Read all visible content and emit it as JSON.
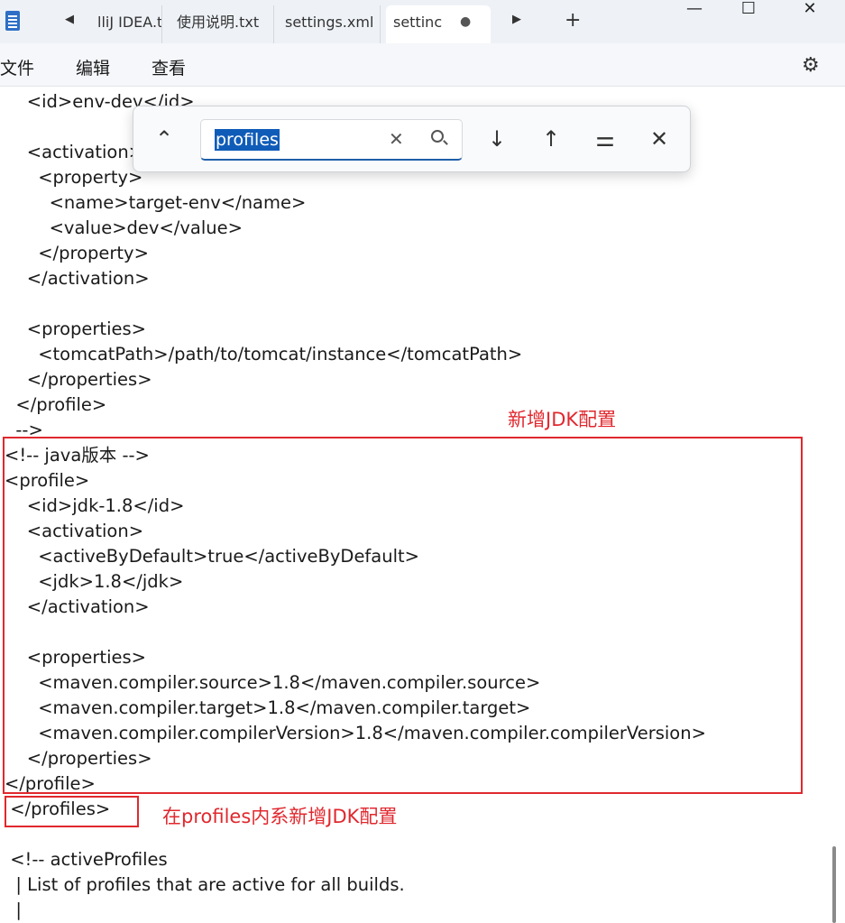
{
  "tabs": [
    {
      "label": "lliJ IDEA.t"
    },
    {
      "label": "使用说明.txt"
    },
    {
      "label": "settings.xml"
    },
    {
      "label": "settinc",
      "active": true,
      "modified": true
    }
  ],
  "tab_bar": {
    "scroll_left": "◀",
    "scroll_right": "▶",
    "add": "+",
    "modified_dot": "●"
  },
  "window_controls": {
    "minimize": "—",
    "maximize": "☐",
    "close": "✕"
  },
  "menu": {
    "file": "文件",
    "edit": "编辑",
    "view": "查看"
  },
  "settings_icon": "gear-icon",
  "find": {
    "query": "profiles",
    "collapse_glyph": "⌃",
    "next_glyph": "↓",
    "prev_glyph": "↑",
    "options_glyph": "⚌",
    "close_glyph": "✕",
    "clear_glyph": "✕"
  },
  "editor": {
    "lines": [
      "    <id>env-dev</id>",
      "",
      "    <activation>",
      "      <property>",
      "        <name>target-env</name>",
      "        <value>dev</value>",
      "      </property>",
      "    </activation>",
      "",
      "    <properties>",
      "      <tomcatPath>/path/to/tomcat/instance</tomcatPath>",
      "    </properties>",
      "  </profile>",
      "  -->",
      "<!-- java版本 -->",
      "<profile>",
      "    <id>jdk-1.8</id>",
      "    <activation>",
      "      <activeByDefault>true</activeByDefault>",
      "      <jdk>1.8</jdk>",
      "    </activation>",
      "",
      "    <properties>",
      "      <maven.compiler.source>1.8</maven.compiler.source>",
      "      <maven.compiler.target>1.8</maven.compiler.target>",
      "      <maven.compiler.compilerVersion>1.8</maven.compiler.compilerVersion>",
      "    </properties>",
      "</profile>",
      " </profiles>",
      "",
      " <!-- activeProfiles",
      "  | List of profiles that are active for all builds.",
      "  |"
    ]
  },
  "annotations": {
    "new_jdk": "新增JDK配置",
    "in_profiles": "在profiles内系新增JDK配置",
    "color": "#e0282e"
  }
}
